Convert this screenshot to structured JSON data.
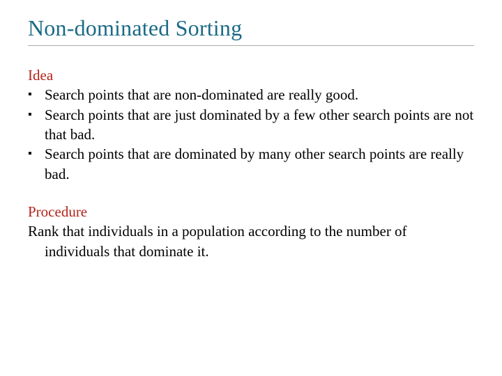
{
  "title": "Non-dominated Sorting",
  "idea": {
    "label": "Idea",
    "bullets": [
      "Search points that are non-dominated are really good.",
      "Search points that are just dominated by a few other search points are not that bad.",
      "Search points that are dominated by many other search points are really bad."
    ]
  },
  "procedure": {
    "label": "Procedure",
    "text": "Rank that individuals in a population according to the number of individuals that dominate it."
  }
}
